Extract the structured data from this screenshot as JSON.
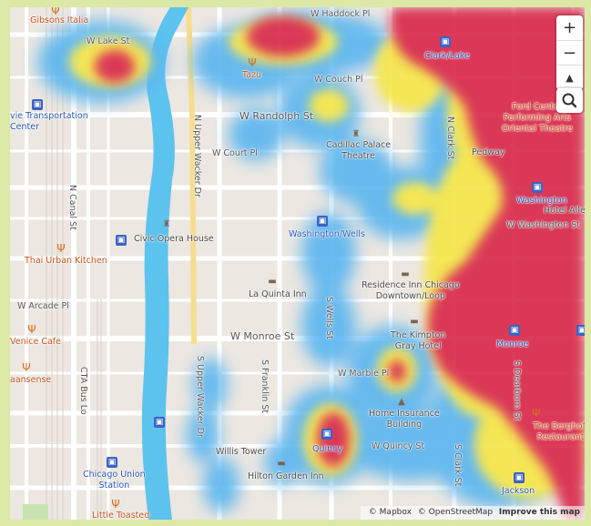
{
  "map": {
    "colors": {
      "land": "#ece7e1",
      "river": "#5cc3ee",
      "road": "#ffffff",
      "highway": "#f6de8d",
      "heat_low": "#5bb6f0",
      "heat_mid": "#f5e64a",
      "heat_high": "#d92b4c",
      "park": "#c7e3b1"
    },
    "streets": {
      "w_lake": "W Lake St",
      "w_couch": "W Couch Pl",
      "w_randolph": "W Randolph St",
      "w_court": "W Court Pl",
      "n_canal": "N Canal St",
      "n_upper_wacker": "N Upper Wacker Dr",
      "n_clark": "N Clark St",
      "w_washington": "W Washington St",
      "w_arcade": "W Arcade Pl",
      "w_monroe": "W Monroe St",
      "s_wells": "S Wells St",
      "w_marble": "W Marble Pl",
      "cta_bus": "CTA Bus Lo",
      "s_upper_wacker": "S Upper Wacker Dr",
      "s_franklin": "S Franklin St",
      "w_quincy": "W Quincy St",
      "s_clark": "S Clark St",
      "s_dearborn": "S Dearborn St",
      "w_hubbard": "W Haddock Pl"
    },
    "places": {
      "gibsons": "Gibsons Italia",
      "ogilvie": "vie Transportation\nCenter",
      "tazu": "Tazu",
      "clark_lake": "Clark/Lake",
      "ford_center": "Ford Center\nPerforming Arts\nOriental Theatre",
      "cadillac": "Cadillac Palace\nTheatre",
      "pedway": "Pedway",
      "washington": "Washington",
      "hotel_alle": "Hotel Alle",
      "civic_opera": "Civic Opera House",
      "washington_wells": "Washington/Wells",
      "thai_urban": "Thai Urban Kitchen",
      "residence_inn": "Residence Inn Chicago\nDowntown/Loop",
      "la_quinta": "La Quinta Inn",
      "venice_cafe": "Venice Cafe",
      "kimpton": "The Kimpton\nGray Hotel",
      "monroe": "Monroe",
      "sense": "aansense",
      "home_insurance": "Home Insurance\nBuilding",
      "berghoff": "The Berghoff\nRestaurant",
      "willis": "Willis Tower",
      "quincy": "Quincy",
      "hilton": "Hilton Garden Inn",
      "union_station": "Chicago Union\nStation",
      "jackson": "Jackson",
      "little_toasted": "Little Toasted"
    },
    "controls": {
      "zoom_in": "+",
      "zoom_out": "−",
      "compass": "▲",
      "inspect_icon": "magnifier-icon"
    },
    "attribution": {
      "mapbox": "© Mapbox",
      "osm": "© OpenStreetMap",
      "improve": "Improve this map"
    }
  }
}
